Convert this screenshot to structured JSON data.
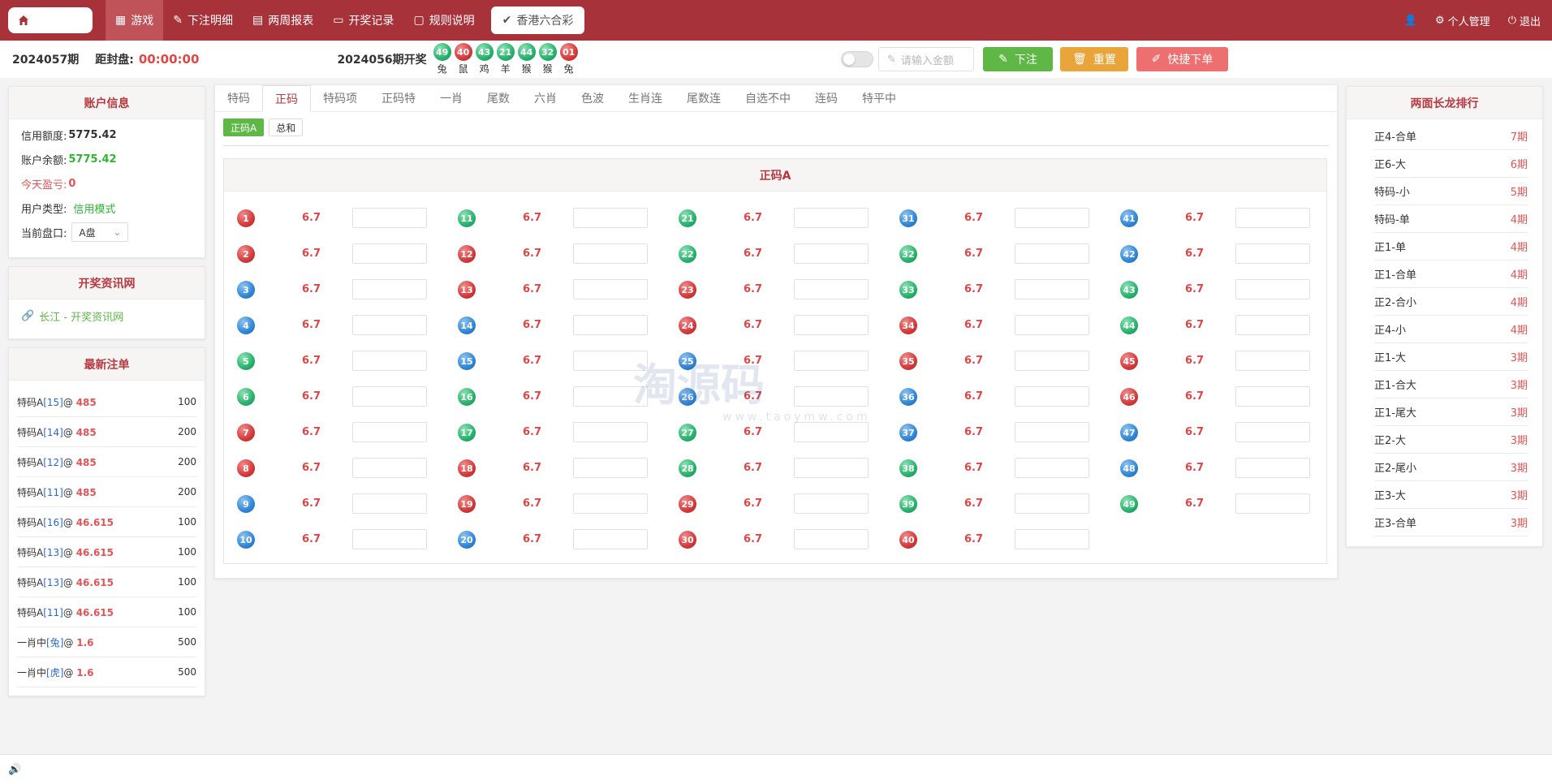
{
  "nav": {
    "items": [
      {
        "label": "游戏",
        "icon": "grid-icon",
        "active": true
      },
      {
        "label": "下注明细",
        "icon": "pencil-icon",
        "active": false
      },
      {
        "label": "两周报表",
        "icon": "list-icon",
        "active": false
      },
      {
        "label": "开奖记录",
        "icon": "monitor-icon",
        "active": false
      },
      {
        "label": "规则说明",
        "icon": "chat-icon",
        "active": false
      }
    ],
    "lottery": "香港六合彩",
    "profile": "个人管理",
    "logout": "退出"
  },
  "infobar": {
    "period": "2024057期",
    "close_label": "距封盘:",
    "countdown": "00:00:00",
    "last_label": "2024056期开奖",
    "last_balls": [
      {
        "num": "49",
        "zodiac": "兔",
        "color": "green"
      },
      {
        "num": "40",
        "zodiac": "鼠",
        "color": "red"
      },
      {
        "num": "43",
        "zodiac": "鸡",
        "color": "green"
      },
      {
        "num": "21",
        "zodiac": "羊",
        "color": "green"
      },
      {
        "num": "44",
        "zodiac": "猴",
        "color": "green"
      },
      {
        "num": "32",
        "zodiac": "猴",
        "color": "green"
      },
      {
        "num": "01",
        "zodiac": "兔",
        "color": "red"
      }
    ],
    "amount_placeholder": "请输入金额",
    "submit": "下注",
    "reset": "重置",
    "quick": "快捷下单"
  },
  "account": {
    "title": "账户信息",
    "credit_label": "信用额度:",
    "credit_value": "5775.42",
    "balance_label": "账户余额:",
    "balance_value": "5775.42",
    "profit_label": "今天盈亏:",
    "profit_value": "0",
    "type_label": "用户类型:",
    "type_value": "信用模式",
    "plate_label": "当前盘口:",
    "plate_value": "A盘"
  },
  "resource": {
    "title": "开奖资讯网",
    "link": "长江 - 开奖资讯网"
  },
  "latest": {
    "title": "最新注单",
    "rows": [
      {
        "name": "特码A",
        "pick": "[15]",
        "odds": "485",
        "amount": "100"
      },
      {
        "name": "特码A",
        "pick": "[14]",
        "odds": "485",
        "amount": "200"
      },
      {
        "name": "特码A",
        "pick": "[12]",
        "odds": "485",
        "amount": "200"
      },
      {
        "name": "特码A",
        "pick": "[11]",
        "odds": "485",
        "amount": "200"
      },
      {
        "name": "特码A",
        "pick": "[16]",
        "odds": "46.615",
        "amount": "100"
      },
      {
        "name": "特码A",
        "pick": "[13]",
        "odds": "46.615",
        "amount": "100"
      },
      {
        "name": "特码A",
        "pick": "[13]",
        "odds": "46.615",
        "amount": "100"
      },
      {
        "name": "特码A",
        "pick": "[11]",
        "odds": "46.615",
        "amount": "100"
      },
      {
        "name": "一肖中",
        "pick": "[兔]",
        "odds": "1.6",
        "amount": "500"
      },
      {
        "name": "一肖中",
        "pick": "[虎]",
        "odds": "1.6",
        "amount": "500"
      }
    ]
  },
  "main": {
    "tabs": [
      "特码",
      "正码",
      "特码项",
      "正码特",
      "一肖",
      "尾数",
      "六肖",
      "色波",
      "生肖连",
      "尾数连",
      "自选不中",
      "连码",
      "特平中"
    ],
    "active_tab": 1,
    "subtabs": [
      "正码A",
      "总和"
    ],
    "active_subtab": 0,
    "section_title": "正码A",
    "odds": "6.7",
    "balls": {
      "red": [
        1,
        2,
        7,
        8,
        12,
        13,
        18,
        19,
        23,
        24,
        29,
        30,
        34,
        35,
        40,
        45,
        46
      ],
      "blue": [
        3,
        4,
        9,
        10,
        14,
        15,
        20,
        25,
        26,
        31,
        36,
        37,
        41,
        42,
        47,
        48
      ],
      "green": [
        5,
        6,
        11,
        16,
        17,
        21,
        22,
        27,
        28,
        32,
        33,
        38,
        39,
        43,
        44,
        49
      ]
    }
  },
  "dragon": {
    "title": "两面长龙排行",
    "rows": [
      {
        "name": "正4-合单",
        "count": "7期"
      },
      {
        "name": "正6-大",
        "count": "6期"
      },
      {
        "name": "特码-小",
        "count": "5期"
      },
      {
        "name": "特码-单",
        "count": "4期"
      },
      {
        "name": "正1-单",
        "count": "4期"
      },
      {
        "name": "正1-合单",
        "count": "4期"
      },
      {
        "name": "正2-合小",
        "count": "4期"
      },
      {
        "name": "正4-小",
        "count": "4期"
      },
      {
        "name": "正1-大",
        "count": "3期"
      },
      {
        "name": "正1-合大",
        "count": "3期"
      },
      {
        "name": "正1-尾大",
        "count": "3期"
      },
      {
        "name": "正2-大",
        "count": "3期"
      },
      {
        "name": "正2-尾小",
        "count": "3期"
      },
      {
        "name": "正3-大",
        "count": "3期"
      },
      {
        "name": "正3-合单",
        "count": "3期"
      }
    ]
  },
  "watermark": {
    "text": "淘源码",
    "sub": "www.taoymw.com"
  }
}
